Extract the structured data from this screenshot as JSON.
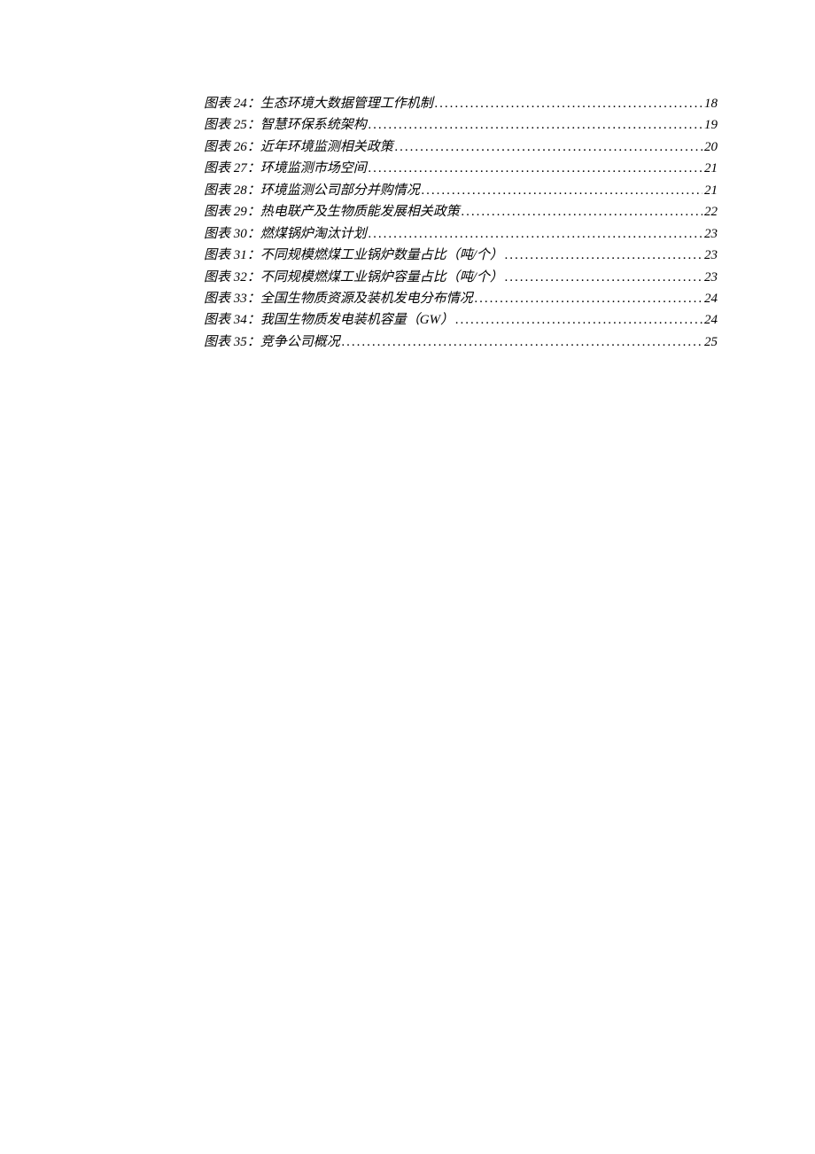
{
  "toc": {
    "entries": [
      {
        "label": "图表 24：生态环境大数据管理工作机制",
        "page": "18"
      },
      {
        "label": "图表 25：智慧环保系统架构",
        "page": "19"
      },
      {
        "label": "图表 26：近年环境监测相关政策",
        "page": "20"
      },
      {
        "label": "图表 27：环境监测市场空间",
        "page": "21"
      },
      {
        "label": "图表 28：环境监测公司部分并购情况",
        "page": "21"
      },
      {
        "label": "图表 29：热电联产及生物质能发展相关政策",
        "page": "22"
      },
      {
        "label": "图表 30：燃煤锅炉淘汰计划",
        "page": "23"
      },
      {
        "label": "图表 31：不同规模燃煤工业锅炉数量占比（吨/个）",
        "page": "23"
      },
      {
        "label": "图表 32：不同规模燃煤工业锅炉容量占比（吨/个）",
        "page": "23"
      },
      {
        "label": "图表 33：全国生物质资源及装机发电分布情况",
        "page": "24"
      },
      {
        "label": "图表 34：我国生物质发电装机容量（GW）",
        "page": "24"
      },
      {
        "label": "图表 35：竞争公司概况",
        "page": "25"
      }
    ]
  }
}
